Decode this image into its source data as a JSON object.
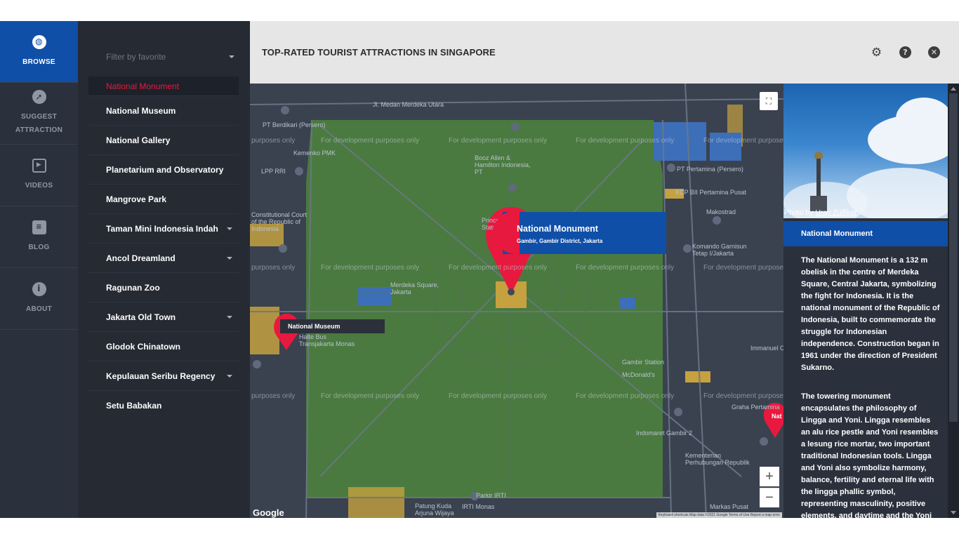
{
  "nav": {
    "items": [
      {
        "label": "BROWSE",
        "icon": "globe-icon"
      },
      {
        "label": "SUGGEST ATTRACTION",
        "icon": "compass-icon"
      },
      {
        "label": "VIDEOS",
        "icon": "play-icon"
      },
      {
        "label": "BLOG",
        "icon": "comment-icon"
      },
      {
        "label": "ABOUT",
        "icon": "info-icon"
      }
    ]
  },
  "list": {
    "filter_placeholder": "Filter by favorite",
    "items": [
      {
        "label": "National Monument"
      },
      {
        "label": "National Museum"
      },
      {
        "label": "National Gallery"
      },
      {
        "label": "Planetarium and Observatory"
      },
      {
        "label": "Mangrove Park"
      },
      {
        "label": "Taman Mini Indonesia Indah"
      },
      {
        "label": "Ancol Dreamland"
      },
      {
        "label": "Ragunan Zoo"
      },
      {
        "label": "Jakarta Old Town"
      },
      {
        "label": "Glodok Chinatown"
      },
      {
        "label": "Kepulauan Seribu Regency"
      },
      {
        "label": "Setu Babakan"
      }
    ]
  },
  "header": {
    "title": "TOP-RATED TOURIST ATTRACTIONS IN SINGAPORE"
  },
  "map": {
    "watermark": "For development purposes only",
    "watermark_cut": "purposes only",
    "popup": {
      "title": "National Monument",
      "subtitle": "Gambir, Gambir District, Jakarta"
    },
    "museum_label": "National Museum",
    "edge_label": "Nat",
    "labels": {
      "merdeka_utara": "Jl. Medan Merdeka Utara",
      "berdikari": "PT Berdikari (Persero)",
      "kemenko": "Kemenko PMK",
      "booz": "Booz Allen & Hamilton Indonesia, PT",
      "pertamina": "PT Pertamina (Persero)",
      "kcp": "KCP BII Pertamina Pusat",
      "makostrad": "Makostrad",
      "lpp": "LPP RRI",
      "court": "Constitutional Court of the Republic of Indonesia",
      "merdeka_sq": "Merdeka Square, Jakarta",
      "halte": "Halte Bus Transjakarta Monas",
      "gambir": "Gambir Station",
      "mcd": "McDonald's",
      "graha": "Graha Pertamina",
      "indomaret": "Indomaret Gambir 2",
      "kementerian": "Kementerian Perhubungan Republik",
      "patung": "Patung Kuda Arjuna Wijaya",
      "irti": "IRTI Monas",
      "markas": "Markas Pusat",
      "parkir": "Parkir IRTI",
      "diponegoro": "Prince Diponegoro Statue",
      "komando": "Komando Garnisun Tetap I/Jakarta",
      "immanuel": "Immanuel C"
    },
    "google": "Google",
    "attribution": "Keyboard shortcuts   Map data ©2021 Google   Terms of Use   Report a map error",
    "zoom_in": "+",
    "zoom_out": "−"
  },
  "detail": {
    "credit_prefix": "Photo by ",
    "credit_author": "Uray Zulfikar",
    "title": "National Monument",
    "para1": "The National Monument is a 132 m obelisk in the centre of Merdeka Square, Central Jakarta, symbolizing the fight for Indonesia. It is the national monument of the Republic of Indonesia, built to commemorate the struggle for Indonesian independence. Construction began in 1961 under the direction of President Sukarno.",
    "para2": "The towering monument encapsulates the philosophy of Lingga and Yoni. Lingga resembles an alu rice pestle and Yoni resembles a lesung rice mortar, two important traditional Indonesian tools. Lingga and Yoni also symbolize harmony, balance, fertility and eternal life with the lingga phallic symbol, representing masculinity, positive elements, and daytime and the Yoni"
  },
  "colors": {
    "accent_blue": "#0f4fa8",
    "marker_red": "#e8193e",
    "park_green": "#4a7a3f",
    "nav_bg": "#2a313d"
  }
}
